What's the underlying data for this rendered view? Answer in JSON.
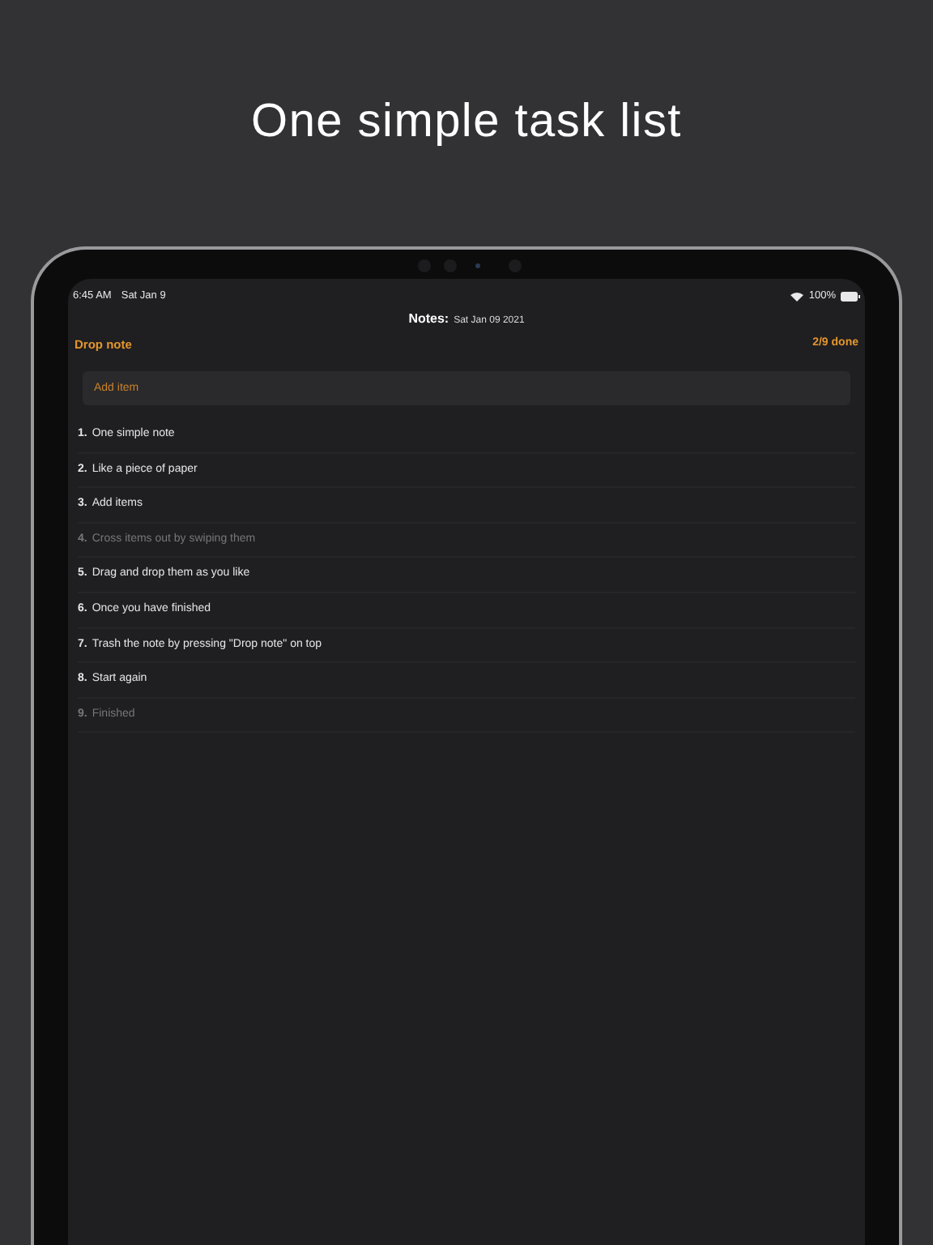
{
  "headline": "One simple task list",
  "status_bar": {
    "time": "6:45 AM",
    "date": "Sat Jan 9",
    "battery": "100%"
  },
  "header": {
    "title": "Notes:",
    "date": "Sat Jan 09 2021"
  },
  "toolbar": {
    "left": "Drop note",
    "right": "2/9 done"
  },
  "add_field": {
    "placeholder": "Add item"
  },
  "items": [
    {
      "number": "1.",
      "text": "One simple note",
      "done": false
    },
    {
      "number": "2.",
      "text": "Like a piece of paper",
      "done": false
    },
    {
      "number": "3.",
      "text": "Add items",
      "done": false
    },
    {
      "number": "4.",
      "text": "Cross items out by swiping them",
      "done": true
    },
    {
      "number": "5.",
      "text": "Drag and drop them as you like",
      "done": false
    },
    {
      "number": "6.",
      "text": "Once you have finished",
      "done": false
    },
    {
      "number": "7.",
      "text": "Trash the note by pressing \"Drop note\" on top",
      "done": false
    },
    {
      "number": "8.",
      "text": "Start again",
      "done": false
    },
    {
      "number": "9.",
      "text": "Finished",
      "done": true
    }
  ]
}
